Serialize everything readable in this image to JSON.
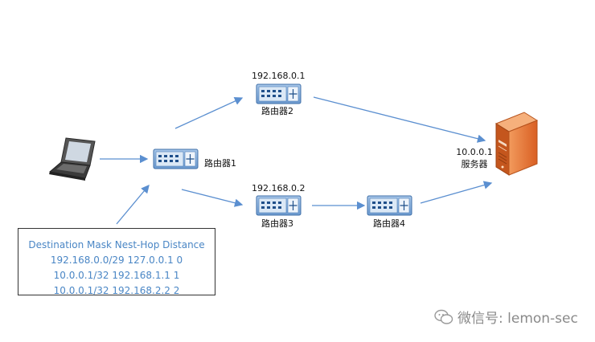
{
  "nodes": {
    "router1": {
      "label": "路由器1"
    },
    "router2": {
      "label": "路由器2",
      "ip": "192.168.0.1"
    },
    "router3": {
      "label": "路由器3",
      "ip": "192.168.0.2"
    },
    "router4": {
      "label": "路由器4"
    },
    "server": {
      "label": "服务器",
      "ip": "10.0.0.1"
    }
  },
  "routing_table": {
    "header": "Destination Mask Nest-Hop Distance",
    "rows": [
      "192.168.0.0/29 127.0.0.1 0",
      "10.0.0.1/32 192.168.1.1 1",
      "10.0.0.1/32 192.168.2.2 2"
    ]
  },
  "watermark": {
    "text": "微信号: lemon-sec"
  },
  "colors": {
    "arrow": "#5b8fd0",
    "router_fill": "#7fa9d8",
    "router_stroke": "#3f6fa8",
    "server": "#e8763a",
    "table_text": "#4a86c5"
  }
}
